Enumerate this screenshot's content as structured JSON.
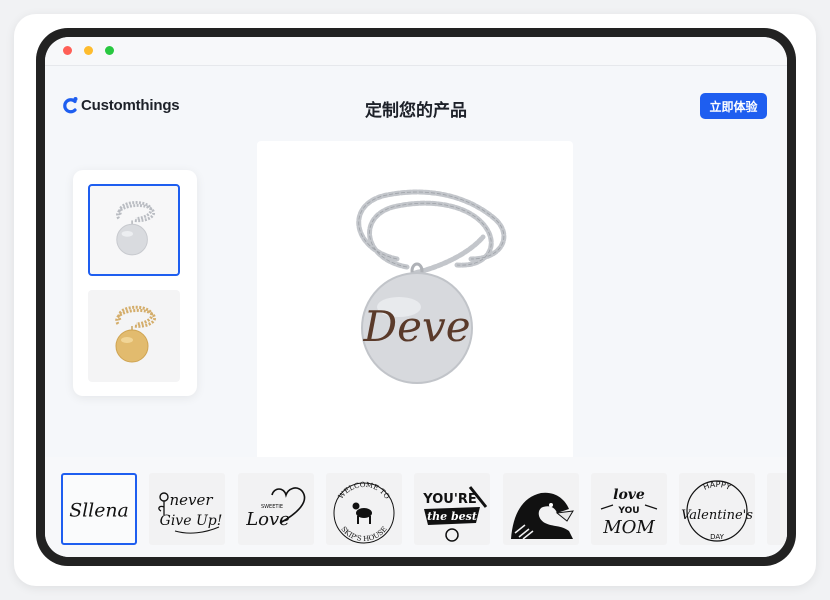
{
  "brand": {
    "name": "Customthings",
    "logo_icon": "customthings-logo-icon",
    "accent": "#1e5ef0"
  },
  "header": {
    "title": "定制您的产品",
    "cta_label": "立即体验"
  },
  "product_thumbnails": [
    {
      "name": "silver-disc-necklace",
      "color": "#c9ccd1",
      "selected": true
    },
    {
      "name": "gold-disc-necklace",
      "color": "#d9b064",
      "selected": false
    }
  ],
  "preview": {
    "engraving": "Deve",
    "pendant_color": "#d7d9dd",
    "chain_color": "#c3c6cb"
  },
  "designs": [
    {
      "name": "design-sllena",
      "text": "Sllena",
      "selected": true
    },
    {
      "name": "design-never-give-up",
      "line1": "never",
      "line2": "Give Up!",
      "selected": false
    },
    {
      "name": "design-sweetie-love",
      "small": "SWEETIE",
      "text": "Love",
      "selected": false
    },
    {
      "name": "design-welcome-skips-house",
      "top": "WELCOME TO",
      "bottom": "SKIP'S HOUSE",
      "selected": false
    },
    {
      "name": "design-youre-the-best",
      "line1": "YOU'RE",
      "line2": "the best",
      "selected": false
    },
    {
      "name": "design-eagle",
      "icon": "eagle-icon",
      "selected": false
    },
    {
      "name": "design-love-you-mom",
      "line1": "love",
      "line2": "YOU",
      "line3": "MOM",
      "selected": false
    },
    {
      "name": "design-happy-valentines-day",
      "top": "HAPPY",
      "text": "Valentine's",
      "bottom": "DAY",
      "selected": false
    }
  ]
}
